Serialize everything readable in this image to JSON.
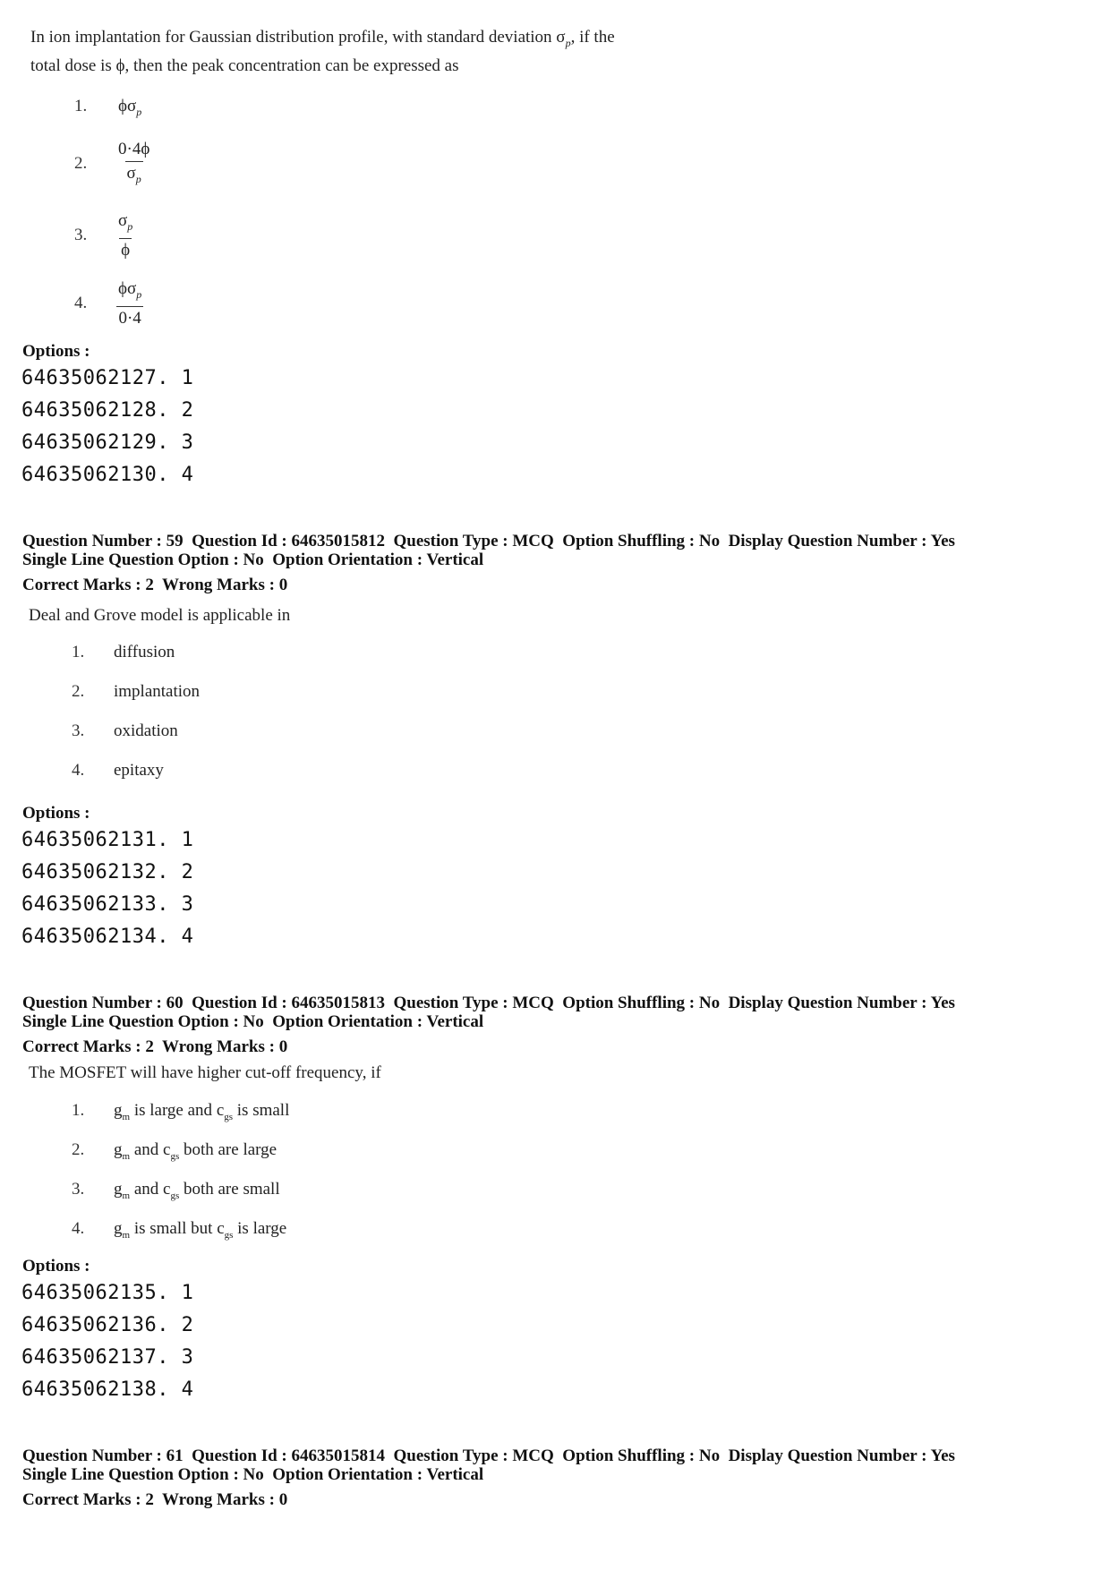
{
  "q58": {
    "text_line1": "In ion implantation for Gaussian distribution profile, with standard deviation σ",
    "text_line1_sub": "p",
    "text_line1_tail": ", if the",
    "text_line2": "total dose is ϕ, then the peak concentration can be expressed as",
    "choices": [
      {
        "num": "1.",
        "expr": "ϕσ",
        "sub": "p"
      },
      {
        "num": "2.",
        "numerator": "0·4ϕ",
        "denominator": "σ",
        "denominator_sub": "p"
      },
      {
        "num": "3.",
        "numerator": "σ",
        "numerator_sub": "p",
        "denominator": "ϕ"
      },
      {
        "num": "4.",
        "numerator": "ϕσ",
        "numerator_sub": "p",
        "denominator": "0·4"
      }
    ],
    "options_label": "Options :",
    "option_ids": [
      "64635062127. 1",
      "64635062128. 2",
      "64635062129. 3",
      "64635062130. 4"
    ]
  },
  "q59": {
    "meta_line1": "Question Number : 59  Question Id : 64635015812  Question Type : MCQ  Option Shuffling : No  Display Question Number : Yes",
    "meta_line2": "Single Line Question Option : No  Option Orientation : Vertical",
    "marks": "Correct Marks : 2  Wrong Marks : 0",
    "text": "Deal and Grove model is applicable in",
    "choices": [
      {
        "num": "1.",
        "text": "diffusion"
      },
      {
        "num": "2.",
        "text": "implantation"
      },
      {
        "num": "3.",
        "text": "oxidation"
      },
      {
        "num": "4.",
        "text": "epitaxy"
      }
    ],
    "options_label": "Options :",
    "option_ids": [
      "64635062131. 1",
      "64635062132. 2",
      "64635062133. 3",
      "64635062134. 4"
    ]
  },
  "q60": {
    "meta_line1": "Question Number : 60  Question Id : 64635015813  Question Type : MCQ  Option Shuffling : No  Display Question Number : Yes",
    "meta_line2": "Single Line Question Option : No  Option Orientation : Vertical",
    "marks": "Correct Marks : 2  Wrong Marks : 0",
    "text": "The MOSFET will have higher cut-off frequency, if",
    "choices": [
      {
        "num": "1.",
        "g": "g",
        "g_sub": "m",
        "mid": " is large and ",
        "c": "c",
        "c_sub": "gs",
        "tail": " is small"
      },
      {
        "num": "2.",
        "g": "g",
        "g_sub": "m",
        "mid": " and ",
        "c": "c",
        "c_sub": "gs",
        "tail": " both are large"
      },
      {
        "num": "3.",
        "g": "g",
        "g_sub": "m",
        "mid": " and ",
        "c": "c",
        "c_sub": "gs",
        "tail": " both are small"
      },
      {
        "num": "4.",
        "g": "g",
        "g_sub": "m",
        "mid": " is small but ",
        "c": "c",
        "c_sub": "gs",
        "tail": " is large"
      }
    ],
    "options_label": "Options :",
    "option_ids": [
      "64635062135. 1",
      "64635062136. 2",
      "64635062137. 3",
      "64635062138. 4"
    ]
  },
  "q61": {
    "meta_line1": "Question Number : 61  Question Id : 64635015814  Question Type : MCQ  Option Shuffling : No  Display Question Number : Yes",
    "meta_line2": "Single Line Question Option : No  Option Orientation : Vertical",
    "marks": "Correct Marks : 2  Wrong Marks : 0"
  }
}
